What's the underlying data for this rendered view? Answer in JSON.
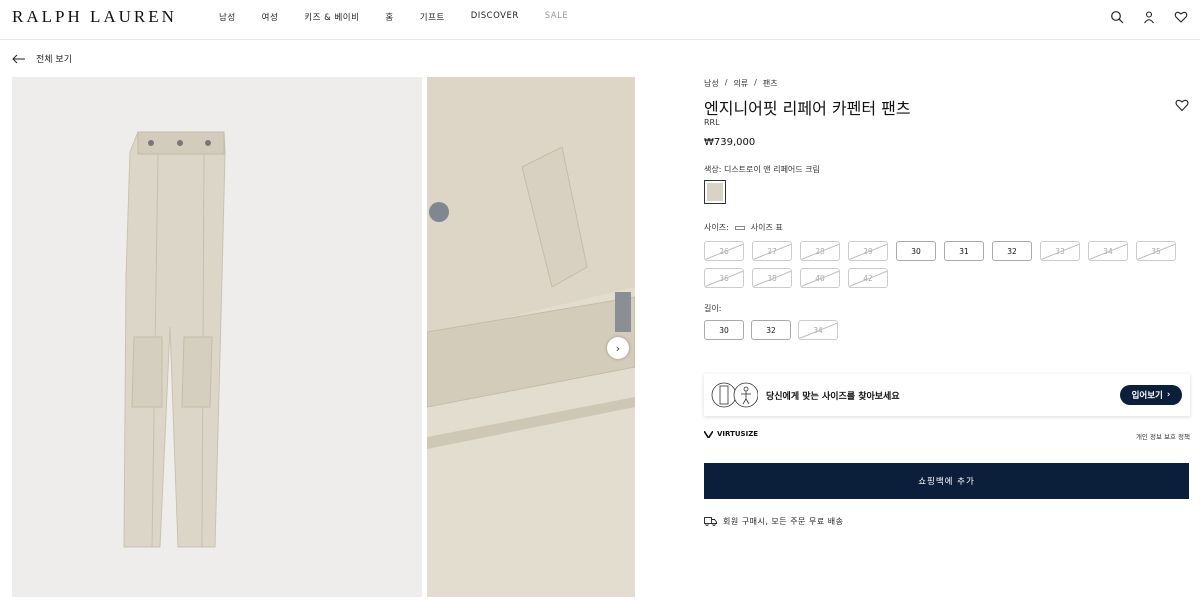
{
  "header": {
    "logo": "RALPH LAUREN",
    "nav": [
      "남성",
      "여성",
      "키즈 & 베이비",
      "홈",
      "기프트",
      "DISCOVER",
      "SALE"
    ],
    "icons": [
      "search-icon",
      "account-icon",
      "wishlist-icon"
    ]
  },
  "back": {
    "label": "전체 보기"
  },
  "gallery": {
    "next_icon": "chevron-right-icon"
  },
  "product": {
    "breadcrumb": [
      "남성",
      "/",
      "의류",
      "/",
      "팬츠"
    ],
    "title": "엔지니어핏 리페어 카펜터 팬츠",
    "brand": "RRL",
    "price": "₩739,000",
    "color_label": "색상: 디스트로이 앤 리페어드 크림",
    "swatch_color": "#d8d3c6",
    "size_label": "사이즈:",
    "size_chart_label": "사이즈 표",
    "sizes": [
      {
        "label": "26",
        "available": false
      },
      {
        "label": "27",
        "available": false
      },
      {
        "label": "28",
        "available": false
      },
      {
        "label": "29",
        "available": false
      },
      {
        "label": "30",
        "available": true
      },
      {
        "label": "31",
        "available": true
      },
      {
        "label": "32",
        "available": true
      },
      {
        "label": "33",
        "available": false
      },
      {
        "label": "34",
        "available": false
      },
      {
        "label": "35",
        "available": false
      },
      {
        "label": "36",
        "available": false
      },
      {
        "label": "38",
        "available": false
      },
      {
        "label": "40",
        "available": false
      },
      {
        "label": "42",
        "available": false
      }
    ],
    "length_label": "길이:",
    "lengths": [
      {
        "label": "30",
        "available": true
      },
      {
        "label": "32",
        "available": true
      },
      {
        "label": "34",
        "available": false
      }
    ]
  },
  "virtusize": {
    "prompt": "당신에게 맞는 사이즈를 찾아보세요",
    "button": "입어보기",
    "logo": "VIRTUSIZE",
    "privacy": "개인 정보 보호 정책"
  },
  "cart": {
    "label": "쇼핑백에 추가"
  },
  "shipping": {
    "label": "회원 구매시, 모든 주문 무료 배송"
  },
  "colors": {
    "navy": "#0c1f3a"
  }
}
